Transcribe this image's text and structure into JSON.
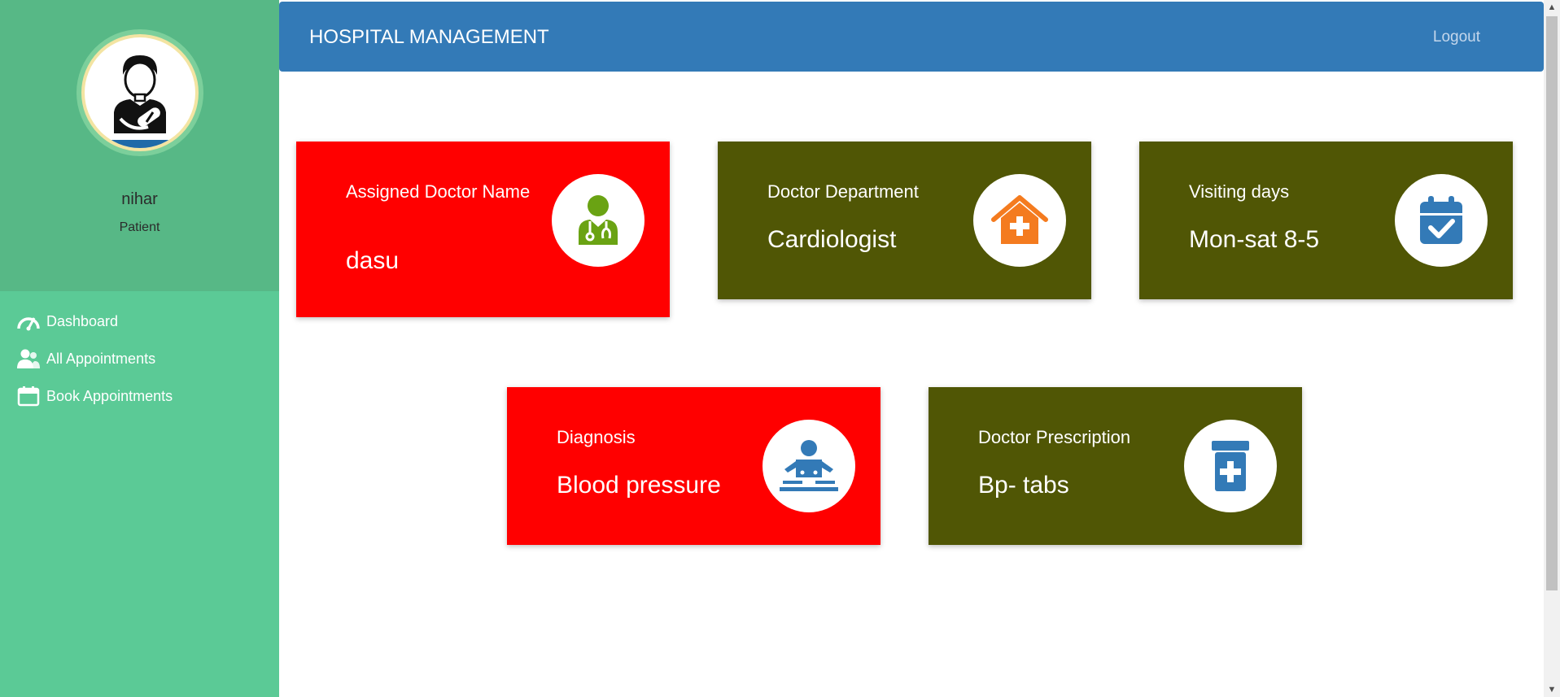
{
  "sidebar": {
    "user_name": "nihar",
    "user_role": "Patient",
    "nav": [
      {
        "label": "Dashboard",
        "icon": "dashboard-icon"
      },
      {
        "label": "All Appointments",
        "icon": "users-icon"
      },
      {
        "label": "Book Appointments",
        "icon": "calendar-icon"
      }
    ]
  },
  "header": {
    "title": "HOSPITAL MANAGEMENT",
    "logout_label": "Logout"
  },
  "cards": [
    {
      "title": "Assigned Doctor Name",
      "value": "dasu",
      "icon": "user-doctor-icon",
      "color": "#ff0000",
      "icon_color": "#6aa313"
    },
    {
      "title": "Doctor Department",
      "value": "Cardiologist",
      "icon": "hospital-house-icon",
      "color": "#505605",
      "icon_color": "#f47b1f"
    },
    {
      "title": "Visiting days",
      "value": "Mon-sat 8-5",
      "icon": "calendar-check-icon",
      "color": "#505605",
      "icon_color": "#337ab7"
    },
    {
      "title": "Diagnosis",
      "value": "Blood pressure",
      "icon": "bed-patient-icon",
      "color": "#ff0000",
      "icon_color": "#337ab7"
    },
    {
      "title": "Doctor Prescription",
      "value": "Bp- tabs",
      "icon": "prescription-bottle-icon",
      "color": "#505605",
      "icon_color": "#337ab7"
    }
  ],
  "colors": {
    "sidebar_bg": "#5bca96",
    "sidebar_top_bg": "#57b886",
    "header_bg": "#337ab7",
    "card_red": "#ff0000",
    "card_olive": "#505605"
  }
}
